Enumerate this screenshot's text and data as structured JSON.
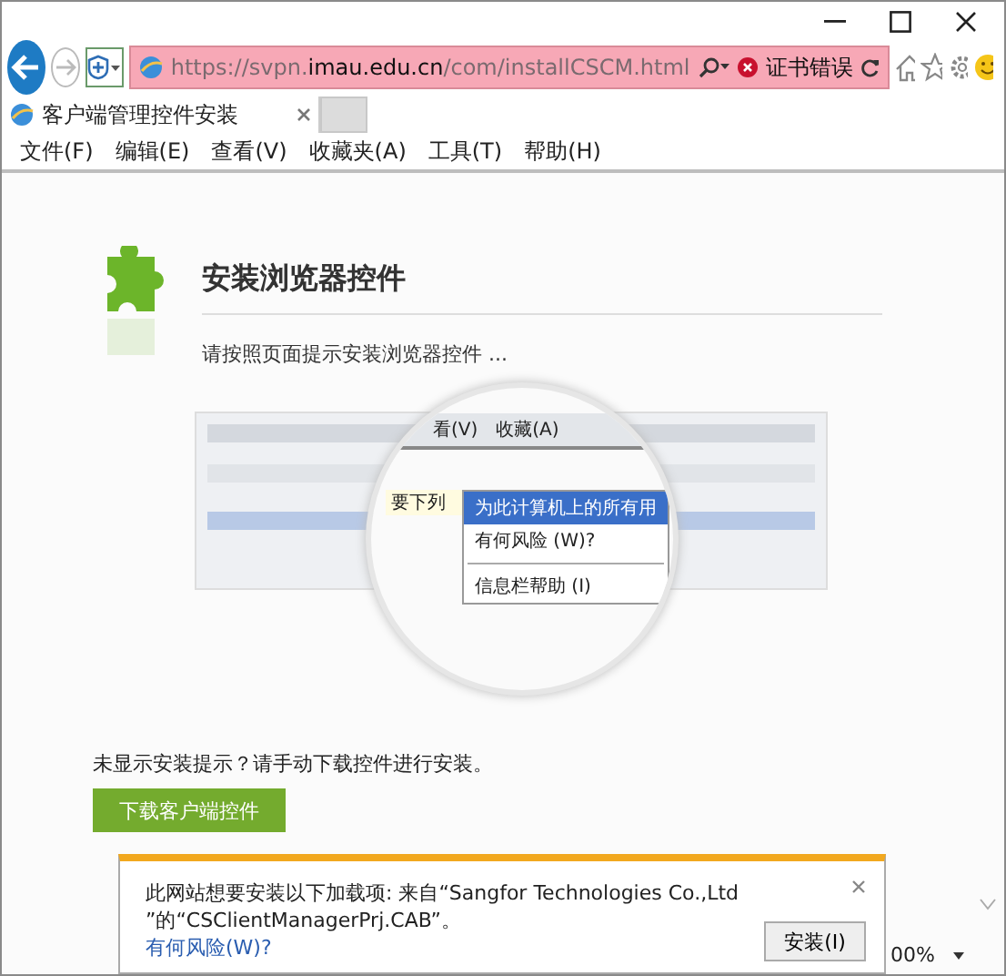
{
  "address_bar": {
    "url_scheme": "https://svpn.",
    "url_domain": "imau.edu.cn",
    "url_path": "/com/installCSCM.html",
    "cert_error": "证书错误"
  },
  "tabs": [
    {
      "title": "客户端管理控件安装",
      "selected": true
    }
  ],
  "menu": [
    "文件(F)",
    "编辑(E)",
    "查看(V)",
    "收藏夹(A)",
    "工具(T)",
    "帮助(H)"
  ],
  "page": {
    "heading": "安装浏览器控件",
    "instruction": "请按照页面提示安装浏览器控件 ...",
    "illustration": {
      "menu_items": [
        "看(V)",
        "收藏(A)"
      ],
      "bar_text": "要下列",
      "popup_items": [
        {
          "label": "为此计算机上的所有用",
          "selected": true
        },
        {
          "label": "有何风险 (W)?",
          "selected": false
        },
        {
          "label": "信息栏帮助 (I)",
          "selected": false
        }
      ]
    },
    "manual_hint": "未显示安装提示？请手动下载控件进行安装。",
    "download_button": "下载客户端控件"
  },
  "notification": {
    "line_1": "此网站想要安装以下加载项: 来自“Sangfor Technologies Co.,Ltd",
    "line_2": "”的“CSClientManagerPrj.CAB”。",
    "link": "有何风险(W)?",
    "install_button": "安装(I)"
  },
  "status_bar": {
    "zoom": "00%"
  }
}
